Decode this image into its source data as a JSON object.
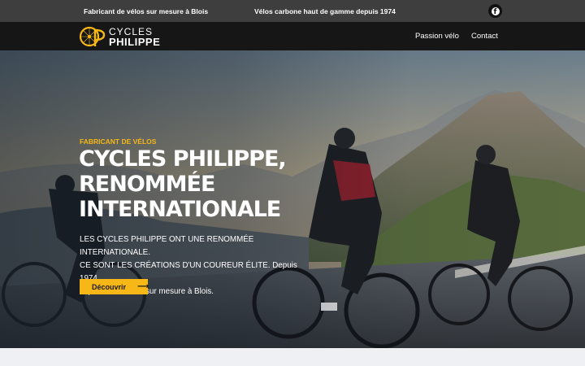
{
  "topbar": {
    "left_text": "Fabricant de vélos sur mesure à Blois",
    "center_text": "Vélos carbone haut de gamme depuis 1974",
    "social_icon": "facebook-icon"
  },
  "nav": {
    "logo_line1": "CYCLES",
    "logo_line2": "PHILIPPE",
    "logo_accent": "#f6b717",
    "links": [
      {
        "label": "Passion vélo"
      },
      {
        "label": "Contact"
      }
    ]
  },
  "hero": {
    "kicker": "FABRICANT DE VÉLOS",
    "title_lines": [
      "CYCLES PHILIPPE,",
      "RENOMMÉE",
      "INTERNATIONALE"
    ],
    "description_lines": [
      "LES CYCLES PHILIPPE ONT UNE RENOMMÉE INTERNATIONALE.",
      "CE SONT LES CRÉATIONS D'UN COUREUR ÉLITE. Depuis 1974,",
      "la passion du vélo sur mesure à Blois."
    ],
    "cta_label": "Découvrir",
    "cta_icon": "arrow-right-icon",
    "accent_color": "#f6b717"
  }
}
